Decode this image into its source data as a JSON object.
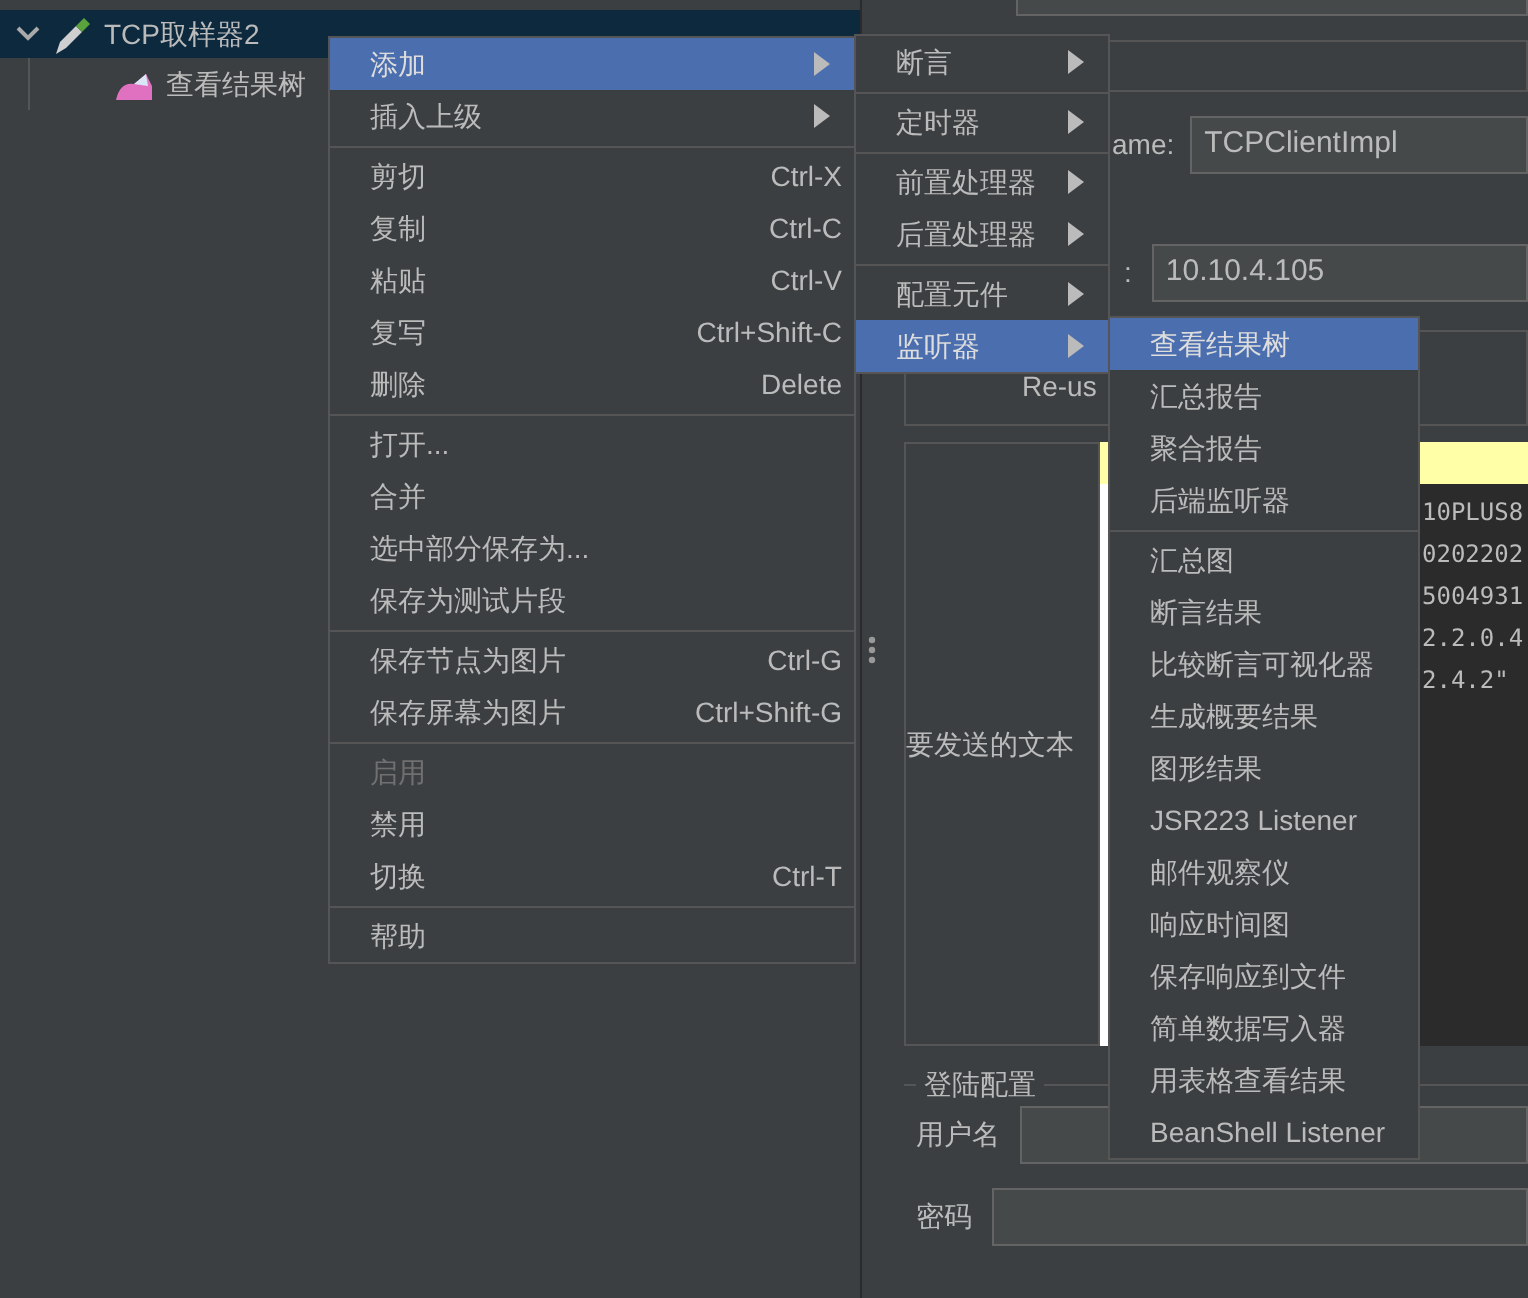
{
  "tree": [
    {
      "label": "TCP取样器2",
      "selected": true,
      "expanded": true,
      "children": [
        {
          "label": "查看结果树",
          "selected": false
        }
      ]
    }
  ],
  "form": {
    "name_label": "ame:",
    "name_value": "TCPClientImpl",
    "server_label": ":",
    "server_value": "10.10.4.105",
    "reuse_label": "Re-us",
    "text_label": "要发送的文本",
    "text_lines": [
      "10PLUS8",
      "0202202",
      "5004931",
      "2.2.0.4",
      "2.4.2\""
    ],
    "login": {
      "title": "登陆配置",
      "username_label": "用户名",
      "password_label": "密码"
    }
  },
  "context_menu": {
    "items": [
      {
        "kind": "item",
        "label": "添加",
        "submenu": true,
        "selected": true,
        "disabled": false
      },
      {
        "kind": "item",
        "label": "插入上级",
        "submenu": true,
        "selected": false,
        "disabled": false
      },
      {
        "kind": "separator"
      },
      {
        "kind": "item",
        "label": "剪切",
        "shortcut": "Ctrl-X",
        "submenu": false,
        "selected": false,
        "disabled": false
      },
      {
        "kind": "item",
        "label": "复制",
        "shortcut": "Ctrl-C",
        "submenu": false,
        "selected": false,
        "disabled": false
      },
      {
        "kind": "item",
        "label": "粘贴",
        "shortcut": "Ctrl-V",
        "submenu": false,
        "selected": false,
        "disabled": false
      },
      {
        "kind": "item",
        "label": "复写",
        "shortcut": "Ctrl+Shift-C",
        "submenu": false,
        "selected": false,
        "disabled": false
      },
      {
        "kind": "item",
        "label": "删除",
        "shortcut": "Delete",
        "submenu": false,
        "selected": false,
        "disabled": false
      },
      {
        "kind": "separator"
      },
      {
        "kind": "item",
        "label": "打开...",
        "submenu": false,
        "selected": false,
        "disabled": false
      },
      {
        "kind": "item",
        "label": "合并",
        "submenu": false,
        "selected": false,
        "disabled": false
      },
      {
        "kind": "item",
        "label": "选中部分保存为...",
        "submenu": false,
        "selected": false,
        "disabled": false
      },
      {
        "kind": "item",
        "label": "保存为测试片段",
        "submenu": false,
        "selected": false,
        "disabled": false
      },
      {
        "kind": "separator"
      },
      {
        "kind": "item",
        "label": "保存节点为图片",
        "shortcut": "Ctrl-G",
        "submenu": false,
        "selected": false,
        "disabled": false
      },
      {
        "kind": "item",
        "label": "保存屏幕为图片",
        "shortcut": "Ctrl+Shift-G",
        "submenu": false,
        "selected": false,
        "disabled": false
      },
      {
        "kind": "separator"
      },
      {
        "kind": "item",
        "label": "启用",
        "submenu": false,
        "selected": false,
        "disabled": true
      },
      {
        "kind": "item",
        "label": "禁用",
        "submenu": false,
        "selected": false,
        "disabled": false
      },
      {
        "kind": "item",
        "label": "切换",
        "shortcut": "Ctrl-T",
        "submenu": false,
        "selected": false,
        "disabled": false
      },
      {
        "kind": "separator"
      },
      {
        "kind": "item",
        "label": "帮助",
        "submenu": false,
        "selected": false,
        "disabled": false
      }
    ]
  },
  "add_submenu": {
    "items": [
      {
        "kind": "item",
        "label": "断言",
        "submenu": true,
        "selected": false
      },
      {
        "kind": "separator"
      },
      {
        "kind": "item",
        "label": "定时器",
        "submenu": true,
        "selected": false
      },
      {
        "kind": "separator"
      },
      {
        "kind": "item",
        "label": "前置处理器",
        "submenu": true,
        "selected": false
      },
      {
        "kind": "item",
        "label": "后置处理器",
        "submenu": true,
        "selected": false
      },
      {
        "kind": "separator"
      },
      {
        "kind": "item",
        "label": "配置元件",
        "submenu": true,
        "selected": false
      },
      {
        "kind": "item",
        "label": "监听器",
        "submenu": true,
        "selected": true
      }
    ]
  },
  "listener_submenu": {
    "items": [
      {
        "kind": "item",
        "label": "查看结果树",
        "submenu": false,
        "selected": true
      },
      {
        "kind": "item",
        "label": "汇总报告",
        "submenu": false,
        "selected": false
      },
      {
        "kind": "item",
        "label": "聚合报告",
        "submenu": false,
        "selected": false
      },
      {
        "kind": "item",
        "label": "后端监听器",
        "submenu": false,
        "selected": false
      },
      {
        "kind": "separator"
      },
      {
        "kind": "item",
        "label": "汇总图",
        "submenu": false,
        "selected": false
      },
      {
        "kind": "item",
        "label": "断言结果",
        "submenu": false,
        "selected": false
      },
      {
        "kind": "item",
        "label": "比较断言可视化器",
        "submenu": false,
        "selected": false
      },
      {
        "kind": "item",
        "label": "生成概要结果",
        "submenu": false,
        "selected": false
      },
      {
        "kind": "item",
        "label": "图形结果",
        "submenu": false,
        "selected": false
      },
      {
        "kind": "item",
        "label": "JSR223 Listener",
        "submenu": false,
        "selected": false
      },
      {
        "kind": "item",
        "label": "邮件观察仪",
        "submenu": false,
        "selected": false
      },
      {
        "kind": "item",
        "label": "响应时间图",
        "submenu": false,
        "selected": false
      },
      {
        "kind": "item",
        "label": "保存响应到文件",
        "submenu": false,
        "selected": false
      },
      {
        "kind": "item",
        "label": "简单数据写入器",
        "submenu": false,
        "selected": false
      },
      {
        "kind": "item",
        "label": "用表格查看结果",
        "submenu": false,
        "selected": false
      },
      {
        "kind": "item",
        "label": "BeanShell Listener",
        "submenu": false,
        "selected": false
      }
    ]
  }
}
